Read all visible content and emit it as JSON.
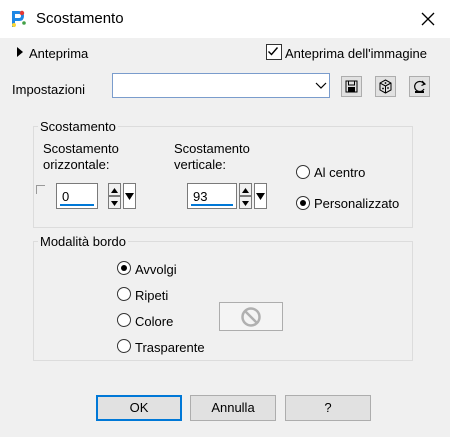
{
  "window": {
    "title": "Scostamento"
  },
  "preview": {
    "label": "Anteprima",
    "image_preview_label": "Anteprima dell'immagine",
    "image_preview_checked": true
  },
  "settings": {
    "label": "Impostazioni",
    "value": ""
  },
  "offset_group": {
    "title": "Scostamento",
    "horizontal_label_line1": "Scostamento",
    "horizontal_label_line2": "orizzontale:",
    "horizontal_value": "0",
    "vertical_label_line1": "Scostamento",
    "vertical_label_line2": "verticale:",
    "vertical_value": "93",
    "center_label": "Al centro",
    "custom_label": "Personalizzato",
    "selected": "custom"
  },
  "border_group": {
    "title": "Modalità bordo",
    "wrap_label": "Avvolgi",
    "repeat_label": "Ripeti",
    "color_label": "Colore",
    "transparent_label": "Trasparente",
    "selected": "wrap"
  },
  "buttons": {
    "ok": "OK",
    "cancel": "Annulla",
    "help": "?"
  },
  "colors": {
    "accent": "#0078d7",
    "border": "#dcdcdc",
    "background": "#f0f0f0"
  }
}
